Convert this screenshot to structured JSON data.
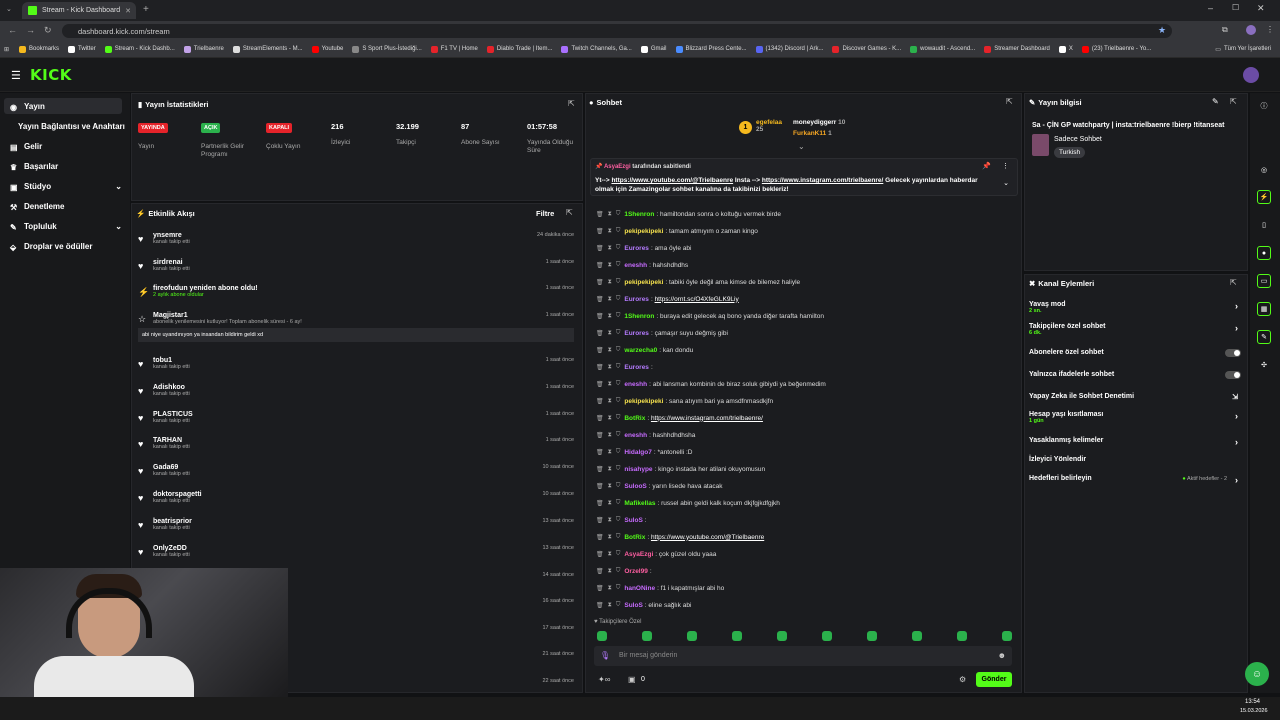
{
  "browser": {
    "tab_title": "Stream - Kick Dashboard",
    "url": "dashboard.kick.com/stream",
    "new_tab": "+",
    "bookmarks": [
      "Bookmarks",
      "Twitter",
      "Stream - Kick Dashb...",
      "Trielbaenre",
      "StreamElements - M...",
      "Youtube",
      "S Sport Plus-İstediği...",
      "F1 TV | Home",
      "Diablo Trade | Item...",
      "Twitch Channels, Ga...",
      "Gmail",
      "Blizzard Press Cente...",
      "(1342) Discord | Ark...",
      "Discover Games - K...",
      "wowaudit - Ascend...",
      "Streamer Dashboard",
      "X",
      "(23) Trielbaenre - Yo..."
    ],
    "all_bookmarks": "Tüm Yer İşaretleri"
  },
  "app": {
    "logo": "KICK"
  },
  "sidebar": {
    "items": [
      "Yayın",
      "Yayın Bağlantısı ve Anahtarı",
      "Gelir",
      "Başarılar",
      "Stüdyo",
      "Denetleme",
      "Topluluk",
      "Droplar ve ödüller"
    ]
  },
  "stats": {
    "title": "Yayın İstatistikleri",
    "items": [
      {
        "badge": "YAYINDA",
        "label": "Yayın",
        "color": "#e5232a"
      },
      {
        "badge": "AÇIK",
        "label": "Partnerlik Gelir Programı",
        "color": "#2bb14c"
      },
      {
        "badge": "KAPALI",
        "label": "Çoklu Yayın",
        "color": "#e5232a"
      },
      {
        "value": "216",
        "label": "İzleyici"
      },
      {
        "value": "32.199",
        "label": "Takipçi"
      },
      {
        "value": "87",
        "label": "Abone Sayısı"
      },
      {
        "value": "01:57:58",
        "label": "Yayında Olduğu Süre"
      }
    ]
  },
  "events": {
    "title": "Etkinlik Akışı",
    "filter": "Filtre",
    "items": [
      {
        "name": "ynsemre",
        "sub": "kanalı takip etti",
        "time": "24 dakika önce"
      },
      {
        "name": "sirdrenai",
        "sub": "kanalı takip etti",
        "time": "1 saat önce"
      },
      {
        "name": "fireofudun yeniden abone oldu!",
        "sub": "2 aylık abone oldular",
        "time": "1 saat önce"
      },
      {
        "name": "Magjistar1",
        "sub": "abonelik yenilemesini kutluyor! Toplam abonelik süresi - 6 ay!",
        "msg": "abi niye uyandınıyon ya insandan bildirim geldi xd",
        "time": "1 saat önce"
      },
      {
        "name": "tobu1",
        "sub": "kanalı takip etti",
        "time": "1 saat önce"
      },
      {
        "name": "Adishkoo",
        "sub": "kanalı takip etti",
        "time": "1 saat önce"
      },
      {
        "name": "PLASTICUS",
        "sub": "kanalı takip etti",
        "time": "1 saat önce"
      },
      {
        "name": "TARHAN",
        "sub": "kanalı takip etti",
        "time": "1 saat önce"
      },
      {
        "name": "Gada69",
        "sub": "kanalı takip etti",
        "time": "10 saat önce"
      },
      {
        "name": "doktorspagetti",
        "sub": "kanalı takip etti",
        "time": "10 saat önce"
      },
      {
        "name": "beatrisprior",
        "sub": "kanalı takip etti",
        "time": "13 saat önce"
      },
      {
        "name": "OnlyZeDD",
        "sub": "kanalı takip etti",
        "time": "13 saat önce"
      },
      {
        "name": "",
        "sub": "",
        "time": "14 saat önce"
      },
      {
        "name": "",
        "sub": "",
        "time": "16 saat önce"
      },
      {
        "name": "",
        "sub": "",
        "time": "17 saat önce"
      },
      {
        "name": "",
        "sub": "",
        "time": "21 saat önce"
      },
      {
        "name": "",
        "sub": "",
        "time": "22 saat önce"
      }
    ]
  },
  "chat": {
    "title": "Sohbet",
    "top": [
      {
        "name": "egefelaa",
        "count": "25"
      },
      {
        "name": "moneydiggerr",
        "count": "10"
      },
      {
        "name": "FurkanK11",
        "count": "1"
      }
    ],
    "rank": "1",
    "pinned": {
      "by": "AsyaEzgi",
      "by_suffix": "tarafından sabitlendi",
      "text1": "Yt-->",
      "link1": "https://www.youtube.com/@Trielbaenre",
      "text2": " Insta -->",
      "link2": "https://www.instagram.com/trielbaenre/",
      "text3": " Gelecek yayınlardan haberdar olmak için Zamazingolar sohbet kanalına da takibinizi bekleriz!"
    },
    "messages": [
      {
        "name": "1Shenron",
        "color": "#53fc18",
        "text": "hamiltondan sonra o koltuğu vermek birde"
      },
      {
        "name": "pekipekipeki",
        "color": "#f4e04d",
        "text": "tamam atmıyım o zaman kingo"
      },
      {
        "name": "Eurores",
        "color": "#b57bff",
        "text": "ama öyle abi"
      },
      {
        "name": "eneshh",
        "color": "#c76bff",
        "text": "hahshdhdhs"
      },
      {
        "name": "pekipekipeki",
        "color": "#f4e04d",
        "text": "tabiki öyle değil ama kimse de bilemez haliyle"
      },
      {
        "name": "Eurores",
        "color": "#b57bff",
        "text": "",
        "link": "https://ornt.sc/O4XfeGLK9Liy"
      },
      {
        "name": "1Shenron",
        "color": "#53fc18",
        "text": "buraya edit gelecek aq bono yanda diğer tarafta hamilton"
      },
      {
        "name": "Eurores",
        "color": "#b57bff",
        "text": "çamaşır suyu değmiş gibi"
      },
      {
        "name": "warzecha0",
        "color": "#53fc18",
        "text": "kan dondu"
      },
      {
        "name": "Eurores",
        "color": "#b57bff",
        "text": ""
      },
      {
        "name": "eneshh",
        "color": "#c76bff",
        "text": "abi lansman kombinin de biraz soluk gibiydi ya beğenmedim"
      },
      {
        "name": "pekipekipeki",
        "color": "#f4e04d",
        "text": "sana atıyım bari ya amsdfnmasdkjfn"
      },
      {
        "name": "BotRix",
        "color": "#53fc18",
        "text": "",
        "link": "https://www.instagram.com/trielbaenre/"
      },
      {
        "name": "eneshh",
        "color": "#c76bff",
        "text": "hashhdhdhsha"
      },
      {
        "name": "Hidalgo7",
        "color": "#c76bff",
        "text": "*antonelli :D"
      },
      {
        "name": "nisahype",
        "color": "#c76bff",
        "text": "kingo instada her atilani okuyomusun"
      },
      {
        "name": "SulooS",
        "color": "#c76bff",
        "text": "yarın lisede hava atacak"
      },
      {
        "name": "Mafikellas",
        "color": "#53fc18",
        "text": "russel abin geldi kalk koçum dkjfgjkdfgjkh"
      },
      {
        "name": "SuloS",
        "color": "#c76bff",
        "text": ""
      },
      {
        "name": "BotRix",
        "color": "#53fc18",
        "text": "",
        "link": "https://www.youtube.com/@Trielbaenre"
      },
      {
        "name": "AsyaEzgi",
        "color": "#ff5fa2",
        "text": "çok güzel oldu yaaa"
      },
      {
        "name": "Orzel99",
        "color": "#ff5fa2",
        "text": ""
      },
      {
        "name": "hanONine",
        "color": "#c76bff",
        "text": "f1 i kapatmışlar abi ho"
      },
      {
        "name": "SuloS",
        "color": "#c76bff",
        "text": "eline sağlık abi"
      }
    ],
    "followers_only": "Takipçilere Özel",
    "input_placeholder": "Bir mesaj gönderin",
    "points": "0",
    "send": "Gönder"
  },
  "info": {
    "title": "Yayın bilgisi",
    "stream_title": "Sa - ÇİN GP watchparty | insta:trielbaenre !bierp !titanseat",
    "category": "Sadece Sohbet",
    "tag": "Turkish"
  },
  "actions": {
    "title": "Kanal Eylemleri",
    "items": [
      {
        "label": "Yavaş mod",
        "sub": "2 sn."
      },
      {
        "label": "Takipçilere özel sohbet",
        "sub": "6 dk."
      },
      {
        "label": "Abonelere özel sohbet",
        "sub": ""
      },
      {
        "label": "Yalnızca ifadelerle sohbet",
        "sub": ""
      },
      {
        "label": "Yapay Zeka ile Sohbet Denetimi",
        "sub": ""
      },
      {
        "label": "Hesap yaşı kısıtlaması",
        "sub": "1 gün"
      },
      {
        "label": "Yasaklanmış kelimeler",
        "sub": ""
      },
      {
        "label": "İzleyici Yönlendir",
        "sub": ""
      },
      {
        "label": "Hedefleri belirleyin",
        "sub": "",
        "right": "Aktif hedefler - 2"
      }
    ]
  },
  "taskbar": {
    "time": "13:54",
    "date": "15.03.2026"
  }
}
